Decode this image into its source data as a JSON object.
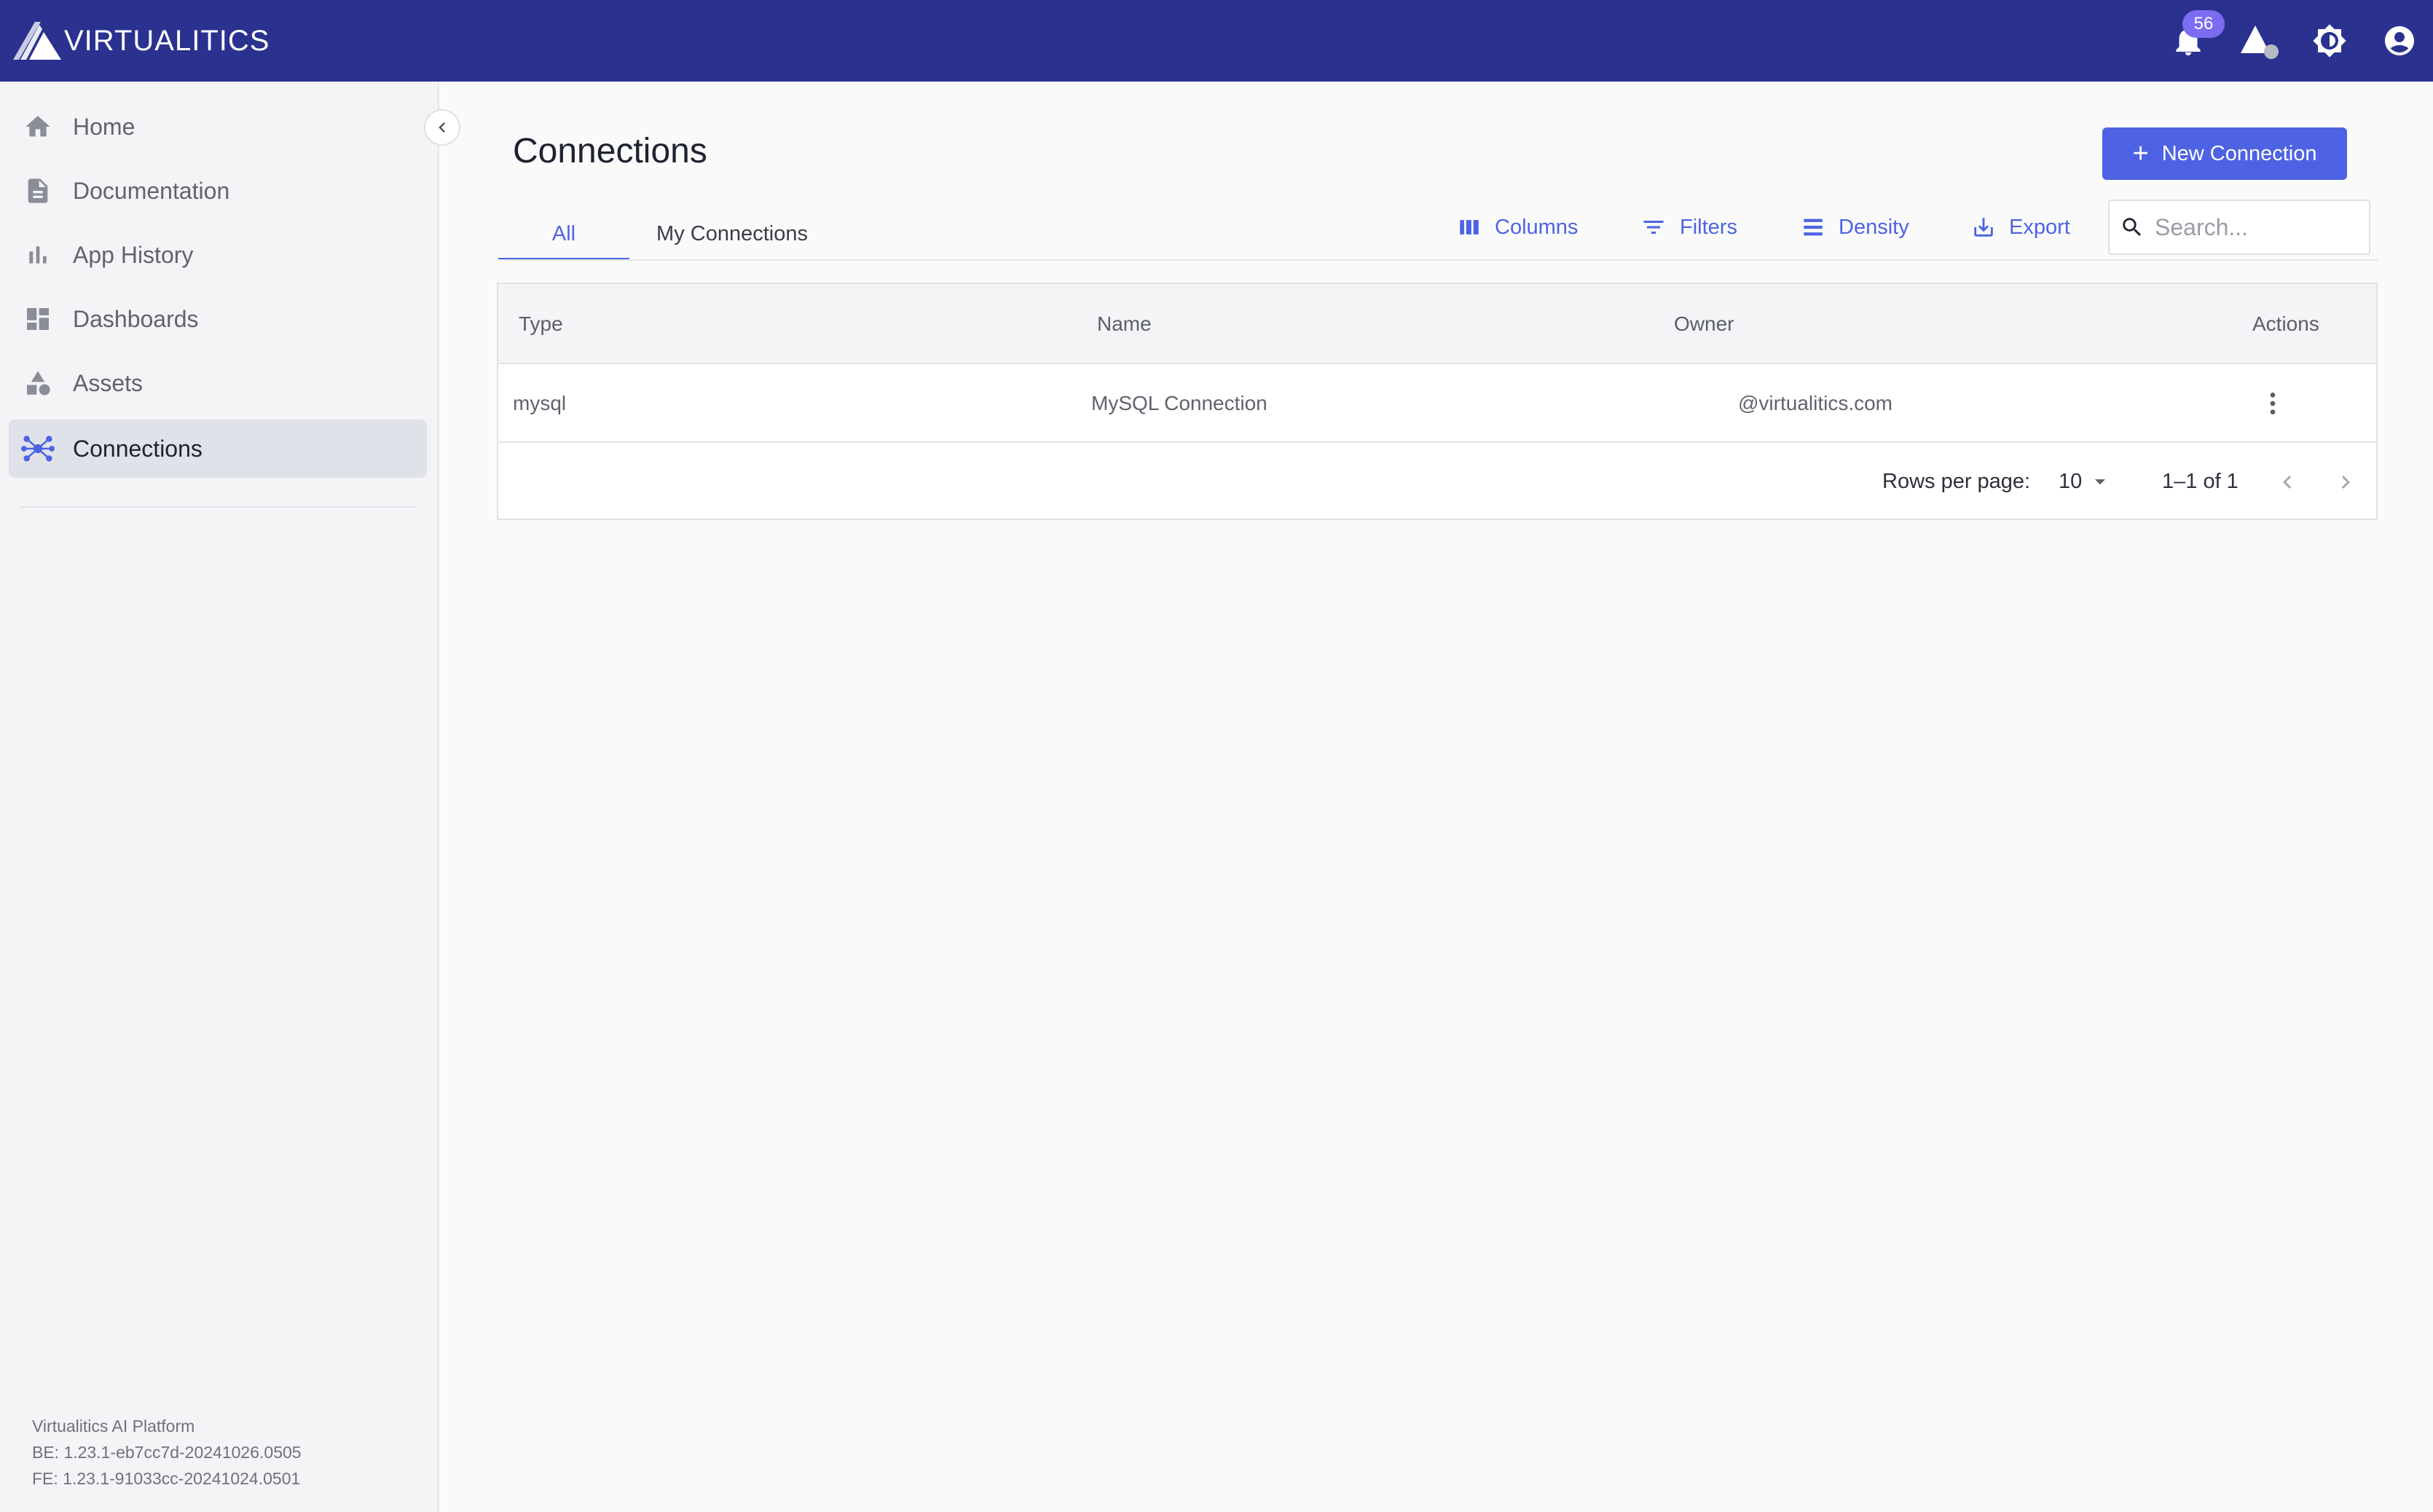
{
  "app": {
    "brand": "VIRTUALITICS",
    "notification_count": "56",
    "colors": {
      "topbar": "#2b318f",
      "accent": "#4d63e3",
      "badge": "#7c6cf1",
      "sidebar_bg": "#f4f4f6",
      "active_item_bg": "#e0e2ea"
    }
  },
  "topbar": {
    "icons": [
      "bell-icon",
      "assets-shape-icon",
      "brightness-icon",
      "account-icon"
    ]
  },
  "sidebar": {
    "items": [
      {
        "label": "Home",
        "icon": "home-icon"
      },
      {
        "label": "Documentation",
        "icon": "document-icon"
      },
      {
        "label": "App History",
        "icon": "bar-chart-icon"
      },
      {
        "label": "Dashboards",
        "icon": "dashboard-icon"
      },
      {
        "label": "Assets",
        "icon": "shapes-icon"
      },
      {
        "label": "Connections",
        "icon": "hub-icon",
        "active": true
      }
    ],
    "version": {
      "platform": "Virtualitics AI Platform",
      "be": "BE: 1.23.1-eb7cc7d-20241026.0505",
      "fe": "FE: 1.23.1-91033cc-20241024.0501"
    }
  },
  "main": {
    "title": "Connections",
    "new_button_label": "New Connection",
    "tabs": [
      {
        "label": "All",
        "active": true
      },
      {
        "label": "My Connections",
        "active": false
      }
    ],
    "toolbar": {
      "columns": "Columns",
      "filters": "Filters",
      "density": "Density",
      "export": "Export"
    },
    "search": {
      "placeholder": "Search...",
      "value": ""
    },
    "table": {
      "headers": {
        "type": "Type",
        "name": "Name",
        "owner": "Owner",
        "actions": "Actions"
      },
      "rows": [
        {
          "type": "mysql",
          "name": "MySQL Connection",
          "owner": "@virtualitics.com"
        }
      ],
      "footer": {
        "rows_per_page_label": "Rows per page:",
        "rows_per_page": "10",
        "range": "1–1 of 1"
      }
    }
  }
}
